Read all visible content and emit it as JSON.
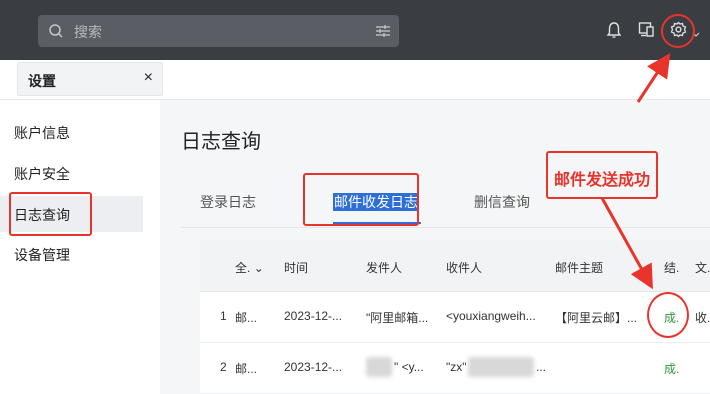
{
  "search": {
    "placeholder": "搜索"
  },
  "header": {
    "icons": [
      "bell-icon",
      "device-icon",
      "gear-icon",
      "chevron-down-icon"
    ]
  },
  "tab": {
    "label": "设置",
    "close": "×"
  },
  "sidebar": {
    "items": [
      {
        "label": "账户信息",
        "active": false
      },
      {
        "label": "账户安全",
        "active": false
      },
      {
        "label": "日志查询",
        "active": true
      },
      {
        "label": "设备管理",
        "active": false
      }
    ]
  },
  "main": {
    "title": "日志查询",
    "tabs": [
      {
        "label": "登录日志",
        "active": false
      },
      {
        "label": "邮件收发日志",
        "active": true
      },
      {
        "label": "删信查询",
        "active": false
      }
    ]
  },
  "table": {
    "headers": [
      "全.",
      "时间",
      "发件人",
      "收件人",
      "邮件主题",
      "结.",
      "文."
    ],
    "rows": [
      {
        "index": "1",
        "type": "邮...",
        "time": "2023-12-...",
        "from": "\"阿里邮箱...",
        "to": "<youxiangweih...",
        "subject": "【阿里云邮】...",
        "result": "成.",
        "file": "收."
      },
      {
        "index": "2",
        "type": "邮...",
        "time": "2023-12-...",
        "from": "\" <y...",
        "to": "\"zx\"",
        "subject": "...",
        "result": "成.",
        "file": ""
      }
    ]
  },
  "annotation": {
    "text": "邮件发送成功",
    "color": "#e8342b"
  },
  "colors": {
    "topbar": "#3a3d42",
    "accent": "#2d6fd6",
    "success": "#2f9a3c"
  }
}
